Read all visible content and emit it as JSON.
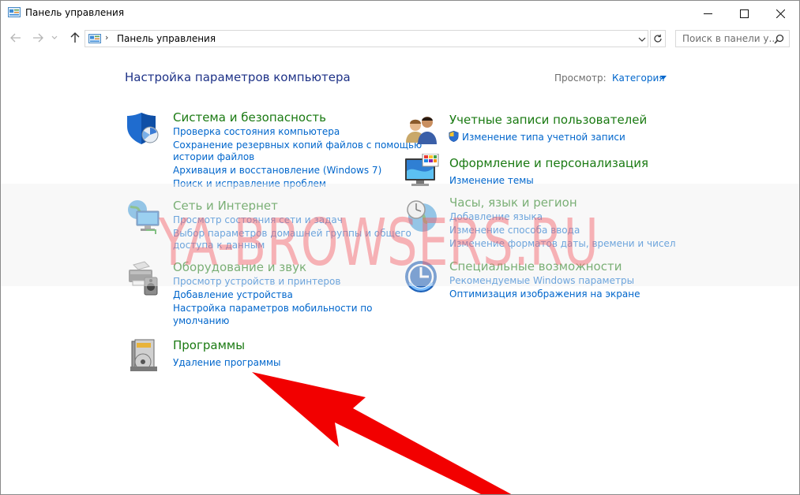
{
  "window": {
    "title": "Панель управления",
    "icon": "control-panel-icon"
  },
  "address": {
    "separator": "›",
    "path": "Панель управления"
  },
  "search": {
    "placeholder": "Поиск в панели у..."
  },
  "main": {
    "heading": "Настройка параметров компьютера",
    "view_label": "Просмотр:",
    "view_value": "Категория"
  },
  "categories": [
    {
      "icon": "shield-icon",
      "title": "Система и безопасность",
      "links": [
        "Проверка состояния компьютера",
        "Сохранение резервных копий файлов с помощью",
        "истории файлов",
        "Архивация и восстановление (Windows 7)",
        "Поиск и исправление проблем"
      ]
    },
    {
      "icon": "network-icon",
      "title": "Сеть и Интернет",
      "links": [
        "Просмотр состояния сети и задач",
        "Выбор параметров домашней группы и общего",
        "доступа к данным"
      ]
    },
    {
      "icon": "printer-icon",
      "title": "Оборудование и звук",
      "links": [
        "Просмотр устройств и принтеров",
        "Добавление устройства",
        "Настройка параметров мобильности по",
        "умолчанию"
      ]
    },
    {
      "icon": "programs-icon",
      "title": "Программы",
      "links": [
        "Удаление программы"
      ]
    },
    {
      "icon": "users-icon",
      "title": "Учетные записи пользователей",
      "links": [
        "Изменение типа учетной записи"
      ]
    },
    {
      "icon": "appearance-icon",
      "title": "Оформление и персонализация",
      "links": [
        "Изменение темы"
      ]
    },
    {
      "icon": "clock-globe-icon",
      "title": "Часы, язык и регион",
      "links": [
        "Добавление языка",
        "Изменение способа ввода",
        "Изменение форматов даты, времени и чисел"
      ]
    },
    {
      "icon": "accessibility-icon",
      "title": "Специальные возможности",
      "links": [
        "Рекомендуемые Windows параметры",
        "Оптимизация изображения на экране"
      ]
    }
  ],
  "watermark": "YA-BROWSERS.RU",
  "colors": {
    "heading": "#1e3287",
    "category_title": "#1a7a12",
    "link": "#0066cc",
    "arrow": "#f20000"
  }
}
